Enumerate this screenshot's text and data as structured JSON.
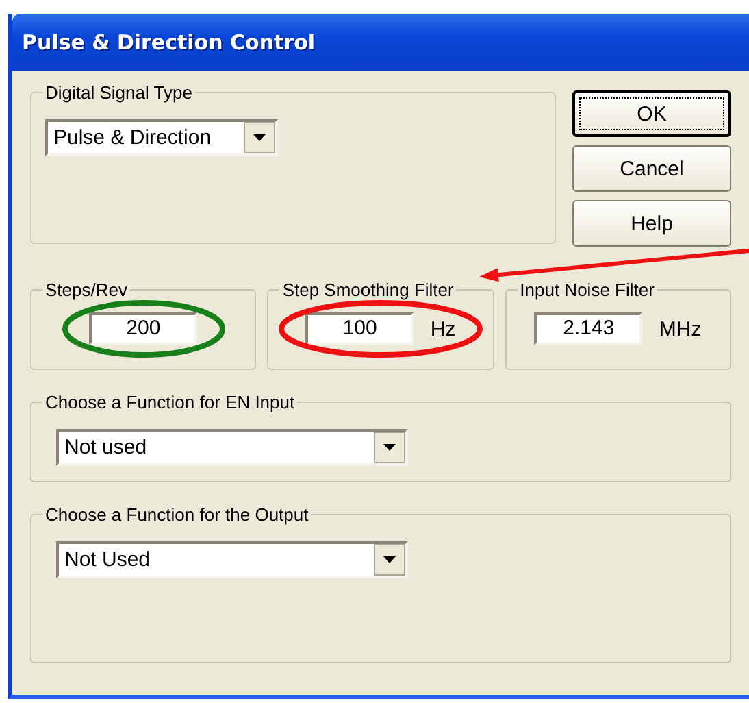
{
  "window": {
    "title": "Pulse & Direction Control"
  },
  "signal_group": {
    "label": "Digital Signal Type",
    "dropdown": {
      "value": "Pulse & Direction"
    }
  },
  "buttons": [
    {
      "label": "OK",
      "default": true
    },
    {
      "label": "Cancel",
      "default": false
    },
    {
      "label": "Help",
      "default": false
    }
  ],
  "filters": [
    {
      "label": "Steps/Rev",
      "value": "200",
      "highlight": {
        "kind": "circle",
        "color": "#17801a"
      }
    },
    {
      "label": "Step Smoothing Filter",
      "value": "100",
      "unit": "Hz",
      "highlight": {
        "kind": "circle",
        "color": "#ee1111"
      }
    },
    {
      "label": "Input Noise Filter",
      "value": "2.143",
      "unit": "MHz"
    }
  ],
  "annotations": [
    {
      "kind": "arrow",
      "color": "#ee1111"
    }
  ],
  "function_groups": [
    {
      "label": "Choose a Function for EN Input",
      "dropdown": {
        "value": "Not used"
      }
    },
    {
      "label": "Choose a Function for the Output",
      "dropdown": {
        "value": "Not Used"
      }
    }
  ]
}
